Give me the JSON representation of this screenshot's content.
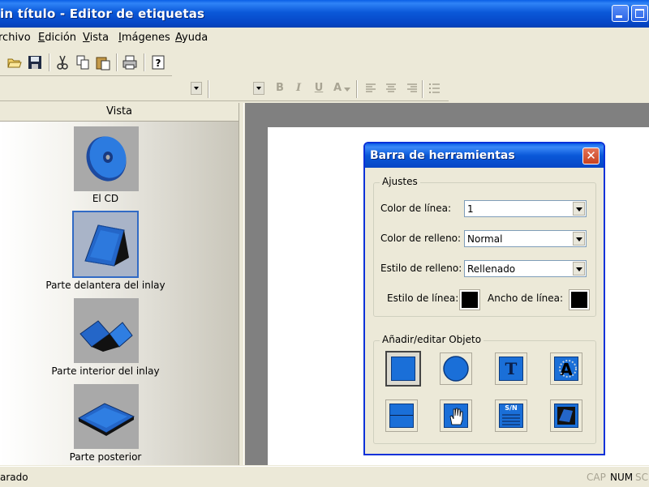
{
  "window": {
    "title": "Sin título - Editor de etiquetas",
    "title_visible": "in título - Editor de etiquetas"
  },
  "menu": {
    "items": [
      "rchivo",
      "Edición",
      "Vista",
      "Imágenes",
      "Ayuda"
    ]
  },
  "toolbar1": {
    "icons": [
      "open-folder-icon",
      "save-icon",
      "cut-icon",
      "copy-icon",
      "paste-icon",
      "print-icon",
      "help-icon"
    ]
  },
  "toolbar2": {
    "format_icons": [
      "bold",
      "italic",
      "underline",
      "font-color",
      "align-left",
      "align-center",
      "align-right",
      "bullets"
    ],
    "labels": {
      "bold": "B",
      "italic": "I",
      "underline": "U",
      "font_color": "A"
    }
  },
  "left_pane": {
    "header": "Vista",
    "items": [
      {
        "label": "El CD",
        "selected": false
      },
      {
        "label": "Parte delantera del inlay",
        "selected": true
      },
      {
        "label": "Parte interior del inlay",
        "selected": false
      },
      {
        "label": "Parte posterior",
        "selected": false
      }
    ]
  },
  "dialog": {
    "title": "Barra de herramientas",
    "close_label": "✕",
    "ajustes": {
      "legend": "Ajustes",
      "line_color_label": "Color de línea:",
      "line_color_value": "1",
      "fill_color_label": "Color de relleno:",
      "fill_color_value": "Normal",
      "fill_style_label": "Estilo de relleno:",
      "fill_style_value": "Rellenado",
      "line_style_label": "Estilo de línea:",
      "line_width_label": "Ancho de línea:"
    },
    "objects": {
      "legend": "Añadir/editar Objeto",
      "buttons": [
        "rectangle",
        "ellipse",
        "text",
        "curved-text",
        "line",
        "select-hand",
        "serial-number",
        "image"
      ],
      "text_glyph": "T",
      "curved_text_glyph": "A",
      "serial_glyph": "S/N"
    }
  },
  "status": {
    "text": "arado",
    "indicators": [
      "CAP",
      "NUM",
      "SC"
    ],
    "active": {
      "CAP": false,
      "NUM": true,
      "SC": false
    }
  },
  "colors": {
    "titlebar": "#0a58d8",
    "accent_blue": "#1a6fd8",
    "close_red": "#c8421f",
    "workspace_gray": "#808080"
  }
}
